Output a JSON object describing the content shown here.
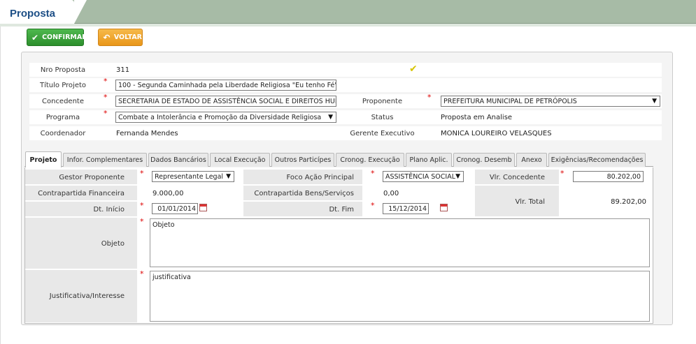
{
  "page": {
    "title": "Proposta"
  },
  "buttons": {
    "confirm": "CONFIRMAR",
    "back": "VOLTAR"
  },
  "header": {
    "nro_label": "Nro Proposta",
    "nro_value": "311",
    "titulo_label": "Título Projeto",
    "titulo_value": "100 - Segunda Caminhada pela Liberdade Religiosa \"Eu tenho Fé\"",
    "concedente_label": "Concedente",
    "concedente_value": "SECRETARIA DE ESTADO DE ASSISTÊNCIA SOCIAL E DIREITOS HUM",
    "proponente_label": "Proponente",
    "proponente_value": "PREFEITURA MUNICIPAL DE PETRÓPOLIS",
    "programa_label": "Programa",
    "programa_value": "Combate a Intolerância e Promoção da Diversidade Religiosa",
    "status_label": "Status",
    "status_value": "Proposta em Analise",
    "coordenador_label": "Coordenador",
    "coordenador_value": "Fernanda Mendes",
    "gerente_label": "Gerente Executivo",
    "gerente_value": "MONICA LOUREIRO VELASQUES"
  },
  "tabs": [
    "Projeto",
    "Infor. Complementares",
    "Dados Bancários",
    "Local Execução",
    "Outros Particípes",
    "Cronog. Execução",
    "Plano Aplic.",
    "Cronog. Desemb",
    "Anexo",
    "Exigências/Recomendações"
  ],
  "projeto": {
    "gestor_label": "Gestor Proponente",
    "gestor_value": "Representante Legal",
    "foco_label": "Foco Ação Principal",
    "foco_value": "ASSISTÊNCIA SOCIAL",
    "vlr_concedente_label": "Vlr. Concedente",
    "vlr_concedente_value": "80.202,00",
    "contrapartida_fin_label": "Contrapartida Financeira",
    "contrapartida_fin_value": "9.000,00",
    "contrapartida_bens_label": "Contrapartida Bens/Serviços",
    "contrapartida_bens_value": "0,00",
    "vlr_total_label": "Vlr. Total",
    "vlr_total_value": "89.202,00",
    "dt_inicio_label": "Dt. Início",
    "dt_inicio_value": "01/01/2014",
    "dt_fim_label": "Dt. Fim",
    "dt_fim_value": "15/12/2014",
    "objeto_label": "Objeto",
    "objeto_value": "Objeto",
    "justificativa_label": "Justificativa/Interesse",
    "justificativa_value": "justificativa"
  },
  "required_mark": "*",
  "icons": {
    "confirm": "check-icon",
    "back": "undo-arrow-icon",
    "status": "checkmark-yellow-icon",
    "dropdown": "dropdown-arrow-icon",
    "calendar": "calendar-icon"
  }
}
